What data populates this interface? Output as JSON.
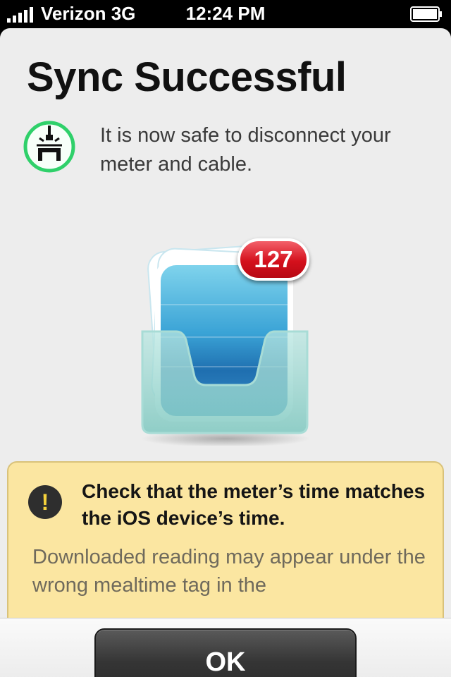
{
  "status_bar": {
    "carrier": "Verizon  3G",
    "time": "12:24 PM",
    "icons": [
      "signal-icon",
      "battery-icon"
    ]
  },
  "screen": {
    "title": "Sync Successful",
    "icon": "unplug-cable-icon",
    "message": "It is now safe to disconnect your meter and cable.",
    "illustration": "inbox-tray-icon",
    "badge_count": "127"
  },
  "warning": {
    "icon": "exclamation-icon",
    "heading": "Check that the meter’s time matches the iOS device’s time.",
    "body": "Downloaded reading may appear under the wrong mealtime tag in the"
  },
  "footer": {
    "ok_label": "OK"
  },
  "colors": {
    "accent_green": "#2fd06a",
    "badge_red": "#d4101c",
    "warning_bg": "#fbe6a1",
    "button_dark": "#353535"
  }
}
